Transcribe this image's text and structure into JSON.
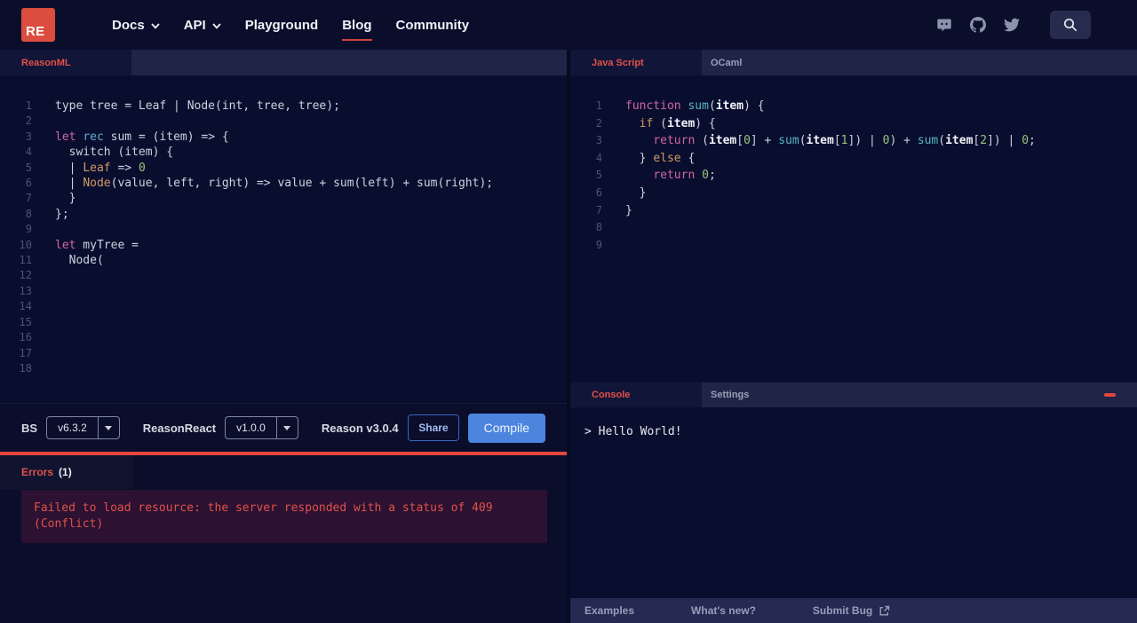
{
  "navbar": {
    "logo": "RE",
    "items": [
      "Docs",
      "API",
      "Playground",
      "Blog",
      "Community"
    ]
  },
  "left": {
    "tab": "ReasonML",
    "code": [
      {
        "n": "1",
        "s": [
          [
            "p",
            "type tree = Leaf | Node(int, tree, tree);"
          ]
        ]
      },
      {
        "n": "2",
        "s": []
      },
      {
        "n": "3",
        "s": [
          [
            "k",
            "let"
          ],
          [
            "p",
            " "
          ],
          [
            "r",
            "rec"
          ],
          [
            "p",
            " sum = (item) => {"
          ]
        ]
      },
      {
        "n": "4",
        "s": [
          [
            "p",
            "  switch (item) {"
          ]
        ]
      },
      {
        "n": "5",
        "s": [
          [
            "p",
            "  | "
          ],
          [
            "o",
            "Leaf"
          ],
          [
            "p",
            " => "
          ],
          [
            "g",
            "0"
          ]
        ]
      },
      {
        "n": "6",
        "s": [
          [
            "p",
            "  | "
          ],
          [
            "o",
            "Node"
          ],
          [
            "p",
            "(value, left, right) => value + sum(left) + sum(right);"
          ]
        ]
      },
      {
        "n": "7",
        "s": [
          [
            "p",
            "  }"
          ]
        ]
      },
      {
        "n": "8",
        "s": [
          [
            "p",
            "};"
          ]
        ]
      },
      {
        "n": "9",
        "s": []
      },
      {
        "n": "10",
        "s": [
          [
            "k",
            "let"
          ],
          [
            "p",
            " myTree ="
          ]
        ]
      },
      {
        "n": "11",
        "s": [
          [
            "p",
            "  Node("
          ]
        ]
      },
      {
        "n": "12",
        "s": []
      },
      {
        "n": "13",
        "s": []
      },
      {
        "n": "14",
        "s": []
      },
      {
        "n": "15",
        "s": []
      },
      {
        "n": "16",
        "s": []
      },
      {
        "n": "17",
        "s": []
      },
      {
        "n": "18",
        "s": []
      }
    ],
    "controls": {
      "bs_label": "BS",
      "bs_version": "v6.3.2",
      "reasonreact_label": "ReasonReact",
      "reasonreact_version": "v1.0.0",
      "reason_version": "Reason v3.0.4",
      "share": "Share",
      "compile": "Compile"
    },
    "errors": {
      "title": "Errors",
      "count": "(1)",
      "message_line1": "Failed to load resource: the server responded with a status of 409",
      "message_line2": "(Conflict)"
    }
  },
  "right": {
    "tabs": [
      "Java Script",
      "OCaml"
    ],
    "code": [
      {
        "n": "1",
        "s": [
          [
            "k",
            "function"
          ],
          [
            "p",
            " "
          ],
          [
            "c",
            "sum"
          ],
          [
            "p",
            "("
          ],
          [
            "b",
            "item"
          ],
          [
            "p",
            ") {"
          ]
        ]
      },
      {
        "n": "2",
        "s": [
          [
            "p",
            "  "
          ],
          [
            "o",
            "if"
          ],
          [
            "p",
            " ("
          ],
          [
            "b",
            "item"
          ],
          [
            "p",
            ") {"
          ]
        ]
      },
      {
        "n": "3",
        "s": [
          [
            "p",
            "    "
          ],
          [
            "k",
            "return"
          ],
          [
            "p",
            " ("
          ],
          [
            "b",
            "item"
          ],
          [
            "p",
            "["
          ],
          [
            "g",
            "0"
          ],
          [
            "p",
            "] + "
          ],
          [
            "c",
            "sum"
          ],
          [
            "p",
            "("
          ],
          [
            "b",
            "item"
          ],
          [
            "p",
            "["
          ],
          [
            "g",
            "1"
          ],
          [
            "p",
            "]) | "
          ],
          [
            "g",
            "0"
          ],
          [
            "p",
            ") + "
          ],
          [
            "c",
            "sum"
          ],
          [
            "p",
            "("
          ],
          [
            "b",
            "item"
          ],
          [
            "p",
            "["
          ],
          [
            "g",
            "2"
          ],
          [
            "p",
            "]) | "
          ],
          [
            "g",
            "0"
          ],
          [
            "p",
            ";"
          ]
        ]
      },
      {
        "n": "4",
        "s": [
          [
            "p",
            "  } "
          ],
          [
            "o",
            "else"
          ],
          [
            "p",
            " {"
          ]
        ]
      },
      {
        "n": "5",
        "s": [
          [
            "p",
            "    "
          ],
          [
            "k",
            "return"
          ],
          [
            "p",
            " "
          ],
          [
            "g",
            "0"
          ],
          [
            "p",
            ";"
          ]
        ]
      },
      {
        "n": "6",
        "s": [
          [
            "p",
            "  }"
          ]
        ]
      },
      {
        "n": "7",
        "s": [
          [
            "p",
            "}"
          ]
        ]
      },
      {
        "n": "8",
        "s": []
      },
      {
        "n": "9",
        "s": []
      }
    ],
    "console": {
      "tabs": [
        "Console",
        "Settings"
      ],
      "output": "> Hello World!"
    },
    "footer": [
      "Examples",
      "What's new?",
      "Submit Bug"
    ]
  }
}
